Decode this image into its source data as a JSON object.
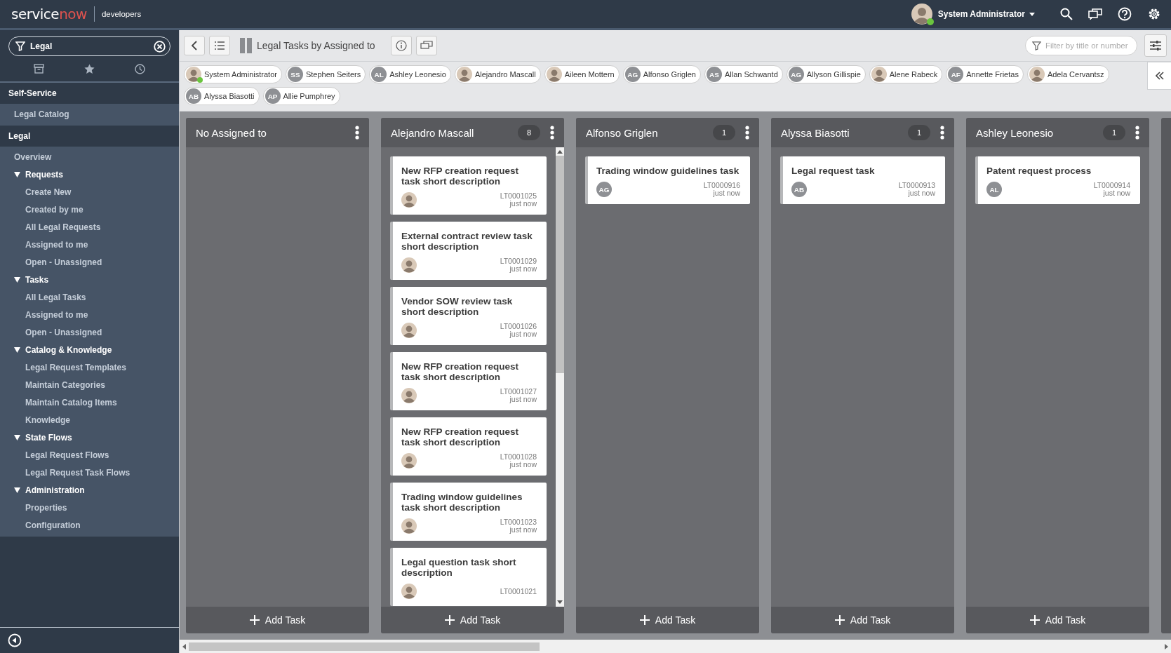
{
  "header": {
    "logo": {
      "part_1": "service",
      "part_2": "now"
    },
    "product": "developers",
    "user": {
      "name": "System Administrator",
      "online": true
    }
  },
  "sidebar": {
    "filter": {
      "value": "Legal"
    },
    "sections": [
      {
        "title": "Self-Service",
        "items": [
          {
            "kind": "link",
            "label": "Legal Catalog"
          }
        ]
      },
      {
        "title": "Legal",
        "items": [
          {
            "kind": "link",
            "label": "Overview"
          },
          {
            "kind": "group",
            "label": "Requests",
            "expanded": true,
            "children": [
              {
                "kind": "link",
                "label": "Create New"
              },
              {
                "kind": "link",
                "label": "Created by me"
              },
              {
                "kind": "link",
                "label": "All Legal Requests"
              },
              {
                "kind": "link",
                "label": "Assigned to me"
              },
              {
                "kind": "link",
                "label": "Open - Unassigned"
              }
            ]
          },
          {
            "kind": "group",
            "label": "Tasks",
            "expanded": true,
            "children": [
              {
                "kind": "link",
                "label": "All Legal Tasks"
              },
              {
                "kind": "link",
                "label": "Assigned to me"
              },
              {
                "kind": "link",
                "label": "Open - Unassigned"
              }
            ]
          },
          {
            "kind": "group",
            "label": "Catalog & Knowledge",
            "expanded": true,
            "children": [
              {
                "kind": "link",
                "label": "Legal Request Templates"
              },
              {
                "kind": "link",
                "label": "Maintain Categories"
              },
              {
                "kind": "link",
                "label": "Maintain Catalog Items"
              },
              {
                "kind": "link",
                "label": "Knowledge"
              }
            ]
          },
          {
            "kind": "group",
            "label": "State Flows",
            "expanded": true,
            "children": [
              {
                "kind": "link",
                "label": "Legal Request Flows"
              },
              {
                "kind": "link",
                "label": "Legal Request Task Flows"
              }
            ]
          },
          {
            "kind": "group",
            "label": "Administration",
            "expanded": true,
            "children": [
              {
                "kind": "link",
                "label": "Properties"
              },
              {
                "kind": "link",
                "label": "Configuration"
              }
            ]
          }
        ]
      }
    ]
  },
  "toolbar": {
    "title": "Legal Tasks by Assigned to",
    "filter": {
      "placeholder": "Filter by title or number"
    }
  },
  "people": [
    {
      "name": "System Administrator",
      "avatar": {
        "kind": "photo"
      },
      "online": true
    },
    {
      "name": "Stephen Seiters",
      "avatar": {
        "kind": "initials",
        "initials": "SS"
      },
      "online": false
    },
    {
      "name": "Ashley Leonesio",
      "avatar": {
        "kind": "initials",
        "initials": "AL"
      },
      "online": false
    },
    {
      "name": "Alejandro Mascall",
      "avatar": {
        "kind": "photo"
      },
      "online": false
    },
    {
      "name": "Aileen Mottern",
      "avatar": {
        "kind": "photo"
      },
      "online": false
    },
    {
      "name": "Alfonso Griglen",
      "avatar": {
        "kind": "initials",
        "initials": "AG"
      },
      "online": false
    },
    {
      "name": "Allan Schwantd",
      "avatar": {
        "kind": "initials",
        "initials": "AS"
      },
      "online": false
    },
    {
      "name": "Allyson Gillispie",
      "avatar": {
        "kind": "initials",
        "initials": "AG"
      },
      "online": false
    },
    {
      "name": "Alene Rabeck",
      "avatar": {
        "kind": "photo"
      },
      "online": false
    },
    {
      "name": "Annette Frietas",
      "avatar": {
        "kind": "initials",
        "initials": "AF"
      },
      "online": false
    },
    {
      "name": "Adela Cervantsz",
      "avatar": {
        "kind": "photo"
      },
      "online": false
    },
    {
      "name": "Alyssa Biasotti",
      "avatar": {
        "kind": "initials",
        "initials": "AB"
      },
      "online": false
    },
    {
      "name": "Allie Pumphrey",
      "avatar": {
        "kind": "initials",
        "initials": "AP"
      },
      "online": false
    }
  ],
  "columns": [
    {
      "title": "No Assigned to",
      "add_label": "Add Task"
    },
    {
      "title": "Alejandro Mascall",
      "count": "8",
      "add_label": "Add Task",
      "cards": [
        {
          "title": "New RFP creation request task short description",
          "number": "LT0001025",
          "time": "just now",
          "avatar": {
            "kind": "photo"
          }
        },
        {
          "title": "External contract review task short description",
          "number": "LT0001029",
          "time": "just now",
          "avatar": {
            "kind": "photo"
          }
        },
        {
          "title": "Vendor SOW review task short description",
          "number": "LT0001026",
          "time": "just now",
          "avatar": {
            "kind": "photo"
          }
        },
        {
          "title": "New RFP creation request task short description",
          "number": "LT0001027",
          "time": "just now",
          "avatar": {
            "kind": "photo"
          }
        },
        {
          "title": "New RFP creation request task short description",
          "number": "LT0001028",
          "time": "just now",
          "avatar": {
            "kind": "photo"
          }
        },
        {
          "title": "Trading window guidelines task short description",
          "number": "LT0001023",
          "time": "just now",
          "avatar": {
            "kind": "photo"
          }
        },
        {
          "title": "Legal question task short description",
          "number": "LT0001021",
          "avatar": {
            "kind": "photo"
          }
        }
      ]
    },
    {
      "title": "Alfonso Griglen",
      "count": "1",
      "add_label": "Add Task",
      "cards": [
        {
          "title": "Trading window guidelines task",
          "number": "LT0000916",
          "time": "just now",
          "avatar": {
            "kind": "initials",
            "initials": "AG"
          }
        }
      ]
    },
    {
      "title": "Alyssa Biasotti",
      "count": "1",
      "add_label": "Add Task",
      "cards": [
        {
          "title": "Legal request task",
          "number": "LT0000913",
          "time": "just now",
          "avatar": {
            "kind": "initials",
            "initials": "AB"
          }
        }
      ]
    },
    {
      "title": "Ashley Leonesio",
      "count": "1",
      "add_label": "Add Task",
      "cards": [
        {
          "title": "Patent request process",
          "number": "LT0000914",
          "time": "just now",
          "avatar": {
            "kind": "initials",
            "initials": "AL"
          }
        }
      ]
    }
  ]
}
